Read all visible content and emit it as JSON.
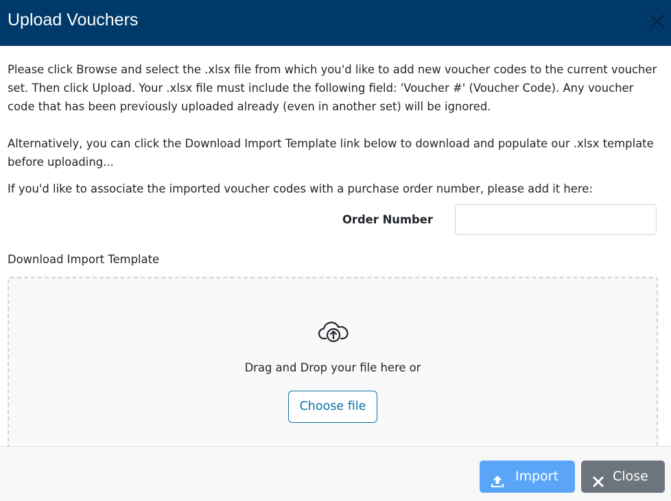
{
  "dialog": {
    "title": "Upload Vouchers",
    "close_icon": "close-icon"
  },
  "body": {
    "instructions": "Please click Browse and select the .xlsx file from which you'd like to add new voucher codes to the current voucher set. Then click Upload. Your .xlsx file must include the following field: 'Voucher #' (Voucher Code). Any voucher code that has been previously uploaded already (even in another set) will be ignored.",
    "alternative": "Alternatively, you can click the Download Import Template link below to download and populate our .xlsx template before uploading...",
    "order_prompt": "If you'd like to associate the imported voucher codes with a purchase order number, please add it here:",
    "order_label": "Order Number",
    "order_value": "",
    "download_link": "Download Import Template"
  },
  "dropzone": {
    "icon": "cloud-upload-icon",
    "text": "Drag and Drop your file here or",
    "choose_label": "Choose file"
  },
  "footer": {
    "import_label": "Import",
    "import_icon": "upload-icon",
    "close_label": "Close",
    "close_icon": "x-icon"
  },
  "colors": {
    "header_bg": "#003a6a",
    "import_bg": "#5aa5f7",
    "close_bg": "#6c757d",
    "link_blue": "#0b6fa8"
  }
}
